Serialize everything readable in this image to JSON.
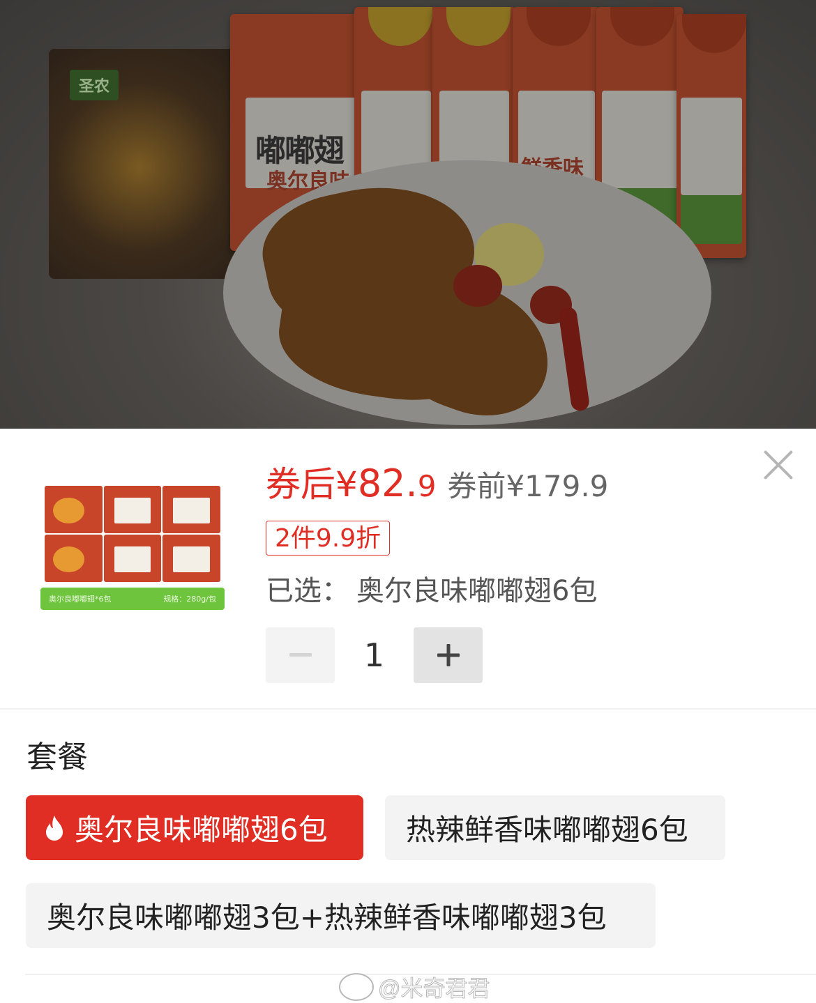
{
  "product": {
    "price_after_prefix": "券后",
    "price_after_currency": "¥",
    "price_after_int": "82.",
    "price_after_dec": "9",
    "price_before": "券前¥179.9",
    "promo_tag": "2件9.9折",
    "selected_label": "已选：",
    "selected_value": "奥尔良味嘟嘟翅6包",
    "quantity": "1",
    "thumb_caption_left": "奥尔良嘟嘟翅*6包",
    "thumb_caption_right": "规格：280g/包"
  },
  "stepper": {
    "minus": "−",
    "plus": "+"
  },
  "packages": {
    "title": "套餐",
    "options": [
      {
        "label": "奥尔良味嘟嘟翅6包",
        "selected": true
      },
      {
        "label": "热辣鲜香味嘟嘟翅6包",
        "selected": false
      },
      {
        "label": "奥尔良味嘟嘟翅3包+热辣鲜香味嘟嘟翅3包",
        "selected": false
      }
    ]
  },
  "backdrop": {
    "brand_logo": "圣农",
    "pkg_title": "嘟嘟翅",
    "pkg_flavor_1": "奥尔良味",
    "pkg_flavor_2": "鲜香味"
  },
  "watermark": "@米奇君君",
  "colors": {
    "accent": "#e02e24",
    "chip_bg": "#f3f3f3",
    "thumb_bar": "#6fc43d"
  },
  "icons": [
    "close-icon",
    "flame-icon",
    "minus-icon",
    "plus-icon",
    "weibo-icon"
  ]
}
